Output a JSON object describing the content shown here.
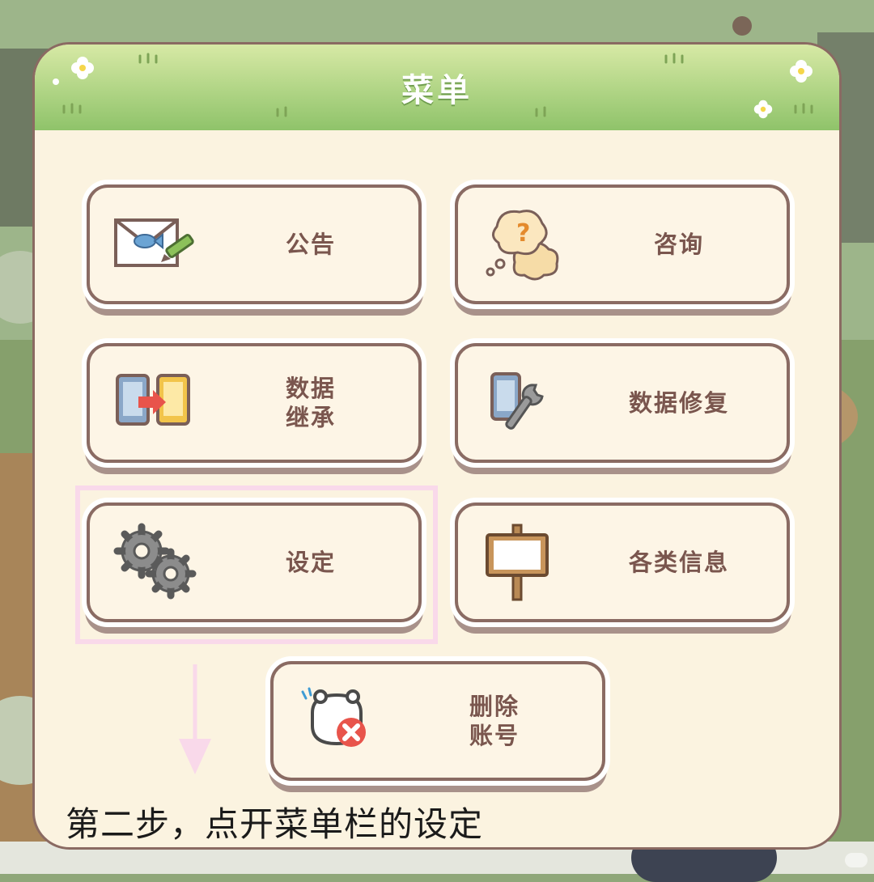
{
  "panel": {
    "title": "菜单"
  },
  "menu": {
    "items": [
      {
        "label": "公告",
        "icon": "mail-icon"
      },
      {
        "label": "咨询",
        "icon": "question-bubble-icon"
      },
      {
        "label": "数据\n继承",
        "icon": "data-transfer-icon"
      },
      {
        "label": "数据修复",
        "icon": "phone-wrench-icon"
      },
      {
        "label": "设定",
        "icon": "gear-icon"
      },
      {
        "label": "各类信息",
        "icon": "signboard-icon"
      },
      {
        "label": "删除\n账号",
        "icon": "delete-account-icon"
      }
    ]
  },
  "annotation": {
    "instruction": "第二步，点开菜单栏的设定",
    "highlight_color": "#f9d9ea"
  },
  "colors": {
    "header_green": "#8fc36a",
    "panel_bg": "#fbf3e0",
    "button_border": "#8a6b63",
    "label_brown": "#7a564e"
  }
}
